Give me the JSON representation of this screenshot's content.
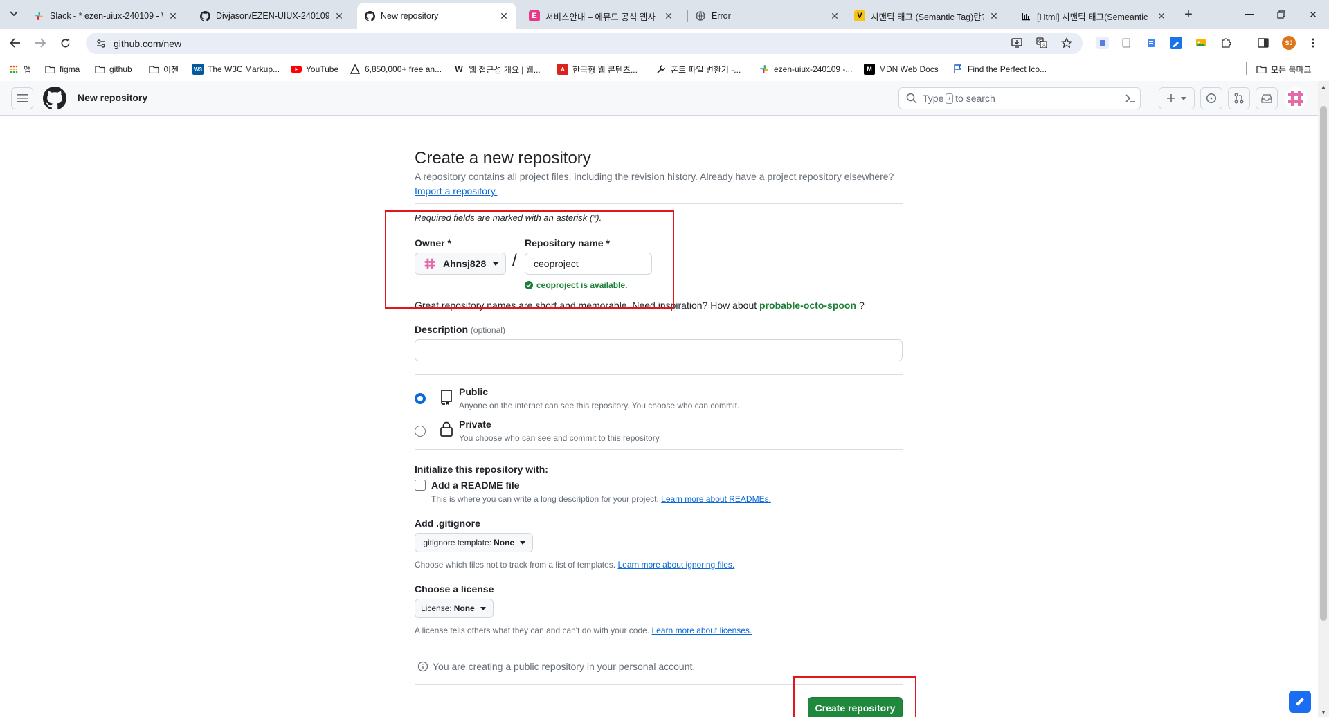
{
  "browser": {
    "tabs": [
      {
        "title": "Slack - * ezen-uiux-240109 - \\",
        "icon": "slack-icon"
      },
      {
        "title": "Divjason/EZEN-UIUX-240109",
        "icon": "github-icon"
      },
      {
        "title": "New repository",
        "icon": "github-icon",
        "active": true
      },
      {
        "title": "서비스안내 – 에뮤드 공식 웹사",
        "icon": "e-favicon-icon"
      },
      {
        "title": "Error",
        "icon": "globe-icon"
      },
      {
        "title": "시맨틱 태그 (Semantic Tag)란?",
        "icon": "velog-icon"
      },
      {
        "title": "[Html] 시맨틱 태그(Semeantic",
        "icon": "tistory-icon"
      }
    ],
    "url": "github.com/new",
    "profile_initials": "SJ",
    "bookmarks": [
      {
        "label": "앱",
        "icon": "apps-grid-icon"
      },
      {
        "label": "figma",
        "icon": "folder-icon"
      },
      {
        "label": "github",
        "icon": "folder-icon"
      },
      {
        "label": "이젠",
        "icon": "folder-icon"
      },
      {
        "label": "The W3C Markup...",
        "icon": "w3c-icon"
      },
      {
        "label": "YouTube",
        "icon": "youtube-icon"
      },
      {
        "label": "6,850,000+ free an...",
        "icon": "flaticon-icon"
      },
      {
        "label": "웹 접근성 개요 | 웹...",
        "icon": "w-icon"
      },
      {
        "label": "한국형 웹 콘텐츠...",
        "icon": "pdf-icon"
      },
      {
        "label": "폰트 파일 변환기 -...",
        "icon": "wrench-icon"
      },
      {
        "label": "ezen-uiux-240109 -...",
        "icon": "slack-icon"
      },
      {
        "label": "MDN Web Docs",
        "icon": "mdn-icon"
      },
      {
        "label": "Find the Perfect Ico...",
        "icon": "flag-icon"
      }
    ],
    "all_bookmarks": "모든 북마크"
  },
  "github_header": {
    "context": "New repository",
    "search_prefix": "Type",
    "search_key": "/",
    "search_suffix": "to search"
  },
  "form": {
    "title": "Create a new repository",
    "subtitle": "A repository contains all project files, including the revision history. Already have a project repository elsewhere?",
    "import_link": "Import a repository.",
    "required_note": "Required fields are marked with an asterisk (*).",
    "owner_label": "Owner *",
    "owner_value": "Ahnsj828",
    "repo_label": "Repository name *",
    "repo_value": "ceoproject",
    "availability": "ceoproject is available.",
    "great_names_prefix": "Great repository names are short and memorable. Need inspiration? How about",
    "suggestion": "probable-octo-spoon",
    "great_names_suffix": "?",
    "description_label": "Description",
    "description_optional": "(optional)",
    "visibility": [
      {
        "label": "Public",
        "desc": "Anyone on the internet can see this repository. You choose who can commit.",
        "checked": true
      },
      {
        "label": "Private",
        "desc": "You choose who can see and commit to this repository.",
        "checked": false
      }
    ],
    "init_label": "Initialize this repository with:",
    "readme_label": "Add a README file",
    "readme_note": "This is where you can write a long description for your project.",
    "readme_link": "Learn more about READMEs.",
    "gitignore_label": "Add .gitignore",
    "gitignore_select_prefix": ".gitignore template:",
    "gitignore_select_value": "None",
    "gitignore_note": "Choose which files not to track from a list of templates.",
    "gitignore_link": "Learn more about ignoring files.",
    "license_label": "Choose a license",
    "license_select_prefix": "License:",
    "license_select_value": "None",
    "license_note": "A license tells others what they can and can't do with your code.",
    "license_link": "Learn more about licenses.",
    "info_message": "You are creating a public repository in your personal account.",
    "submit_label": "Create repository"
  },
  "colors": {
    "primary_green": "#1f883d",
    "link_blue": "#0969da",
    "annotation_red": "#e3161b"
  }
}
